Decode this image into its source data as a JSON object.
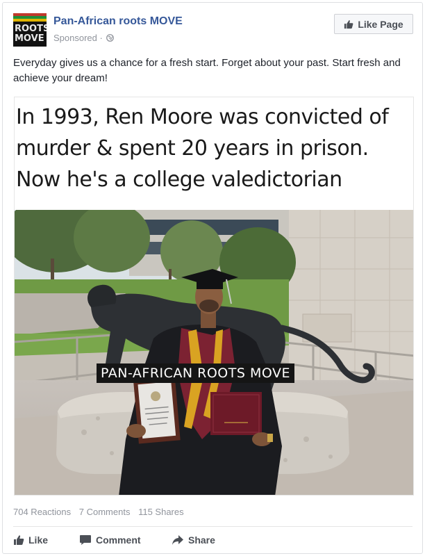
{
  "post": {
    "page_name": "Pan-African roots MOVE",
    "sponsored_label": "Sponsored ·",
    "like_page_label": "Like Page",
    "logo_line1": "ROOTS",
    "logo_line2": "MOVE",
    "text": "Everyday gives us a chance for a fresh start. Forget about your past. Start fresh and achieve your dream!",
    "media": {
      "headline": "In 1993, Ren Moore was convicted of murder & spent 20 years in prison. Now he's a college valedictorian",
      "caption": "PAN-AFRICAN ROOTS MOVE",
      "plaque_text": "",
      "folder_text": ""
    }
  },
  "stats": {
    "reactions": "704 Reactions",
    "comments": "7 Comments",
    "shares": "115 Shares"
  },
  "actions": {
    "like": "Like",
    "comment": "Comment",
    "share": "Share"
  },
  "colors": {
    "link_blue": "#365899",
    "meta_gray": "#90949c",
    "logo_bands": [
      "#c0392b",
      "#1e8f3a",
      "#e0b400"
    ]
  },
  "icons": {
    "like_page": "thumbs-up-icon",
    "sponsored": "globe-icon",
    "like": "thumbs-up-icon",
    "comment": "comment-bubble-icon",
    "share": "share-arrow-icon"
  }
}
